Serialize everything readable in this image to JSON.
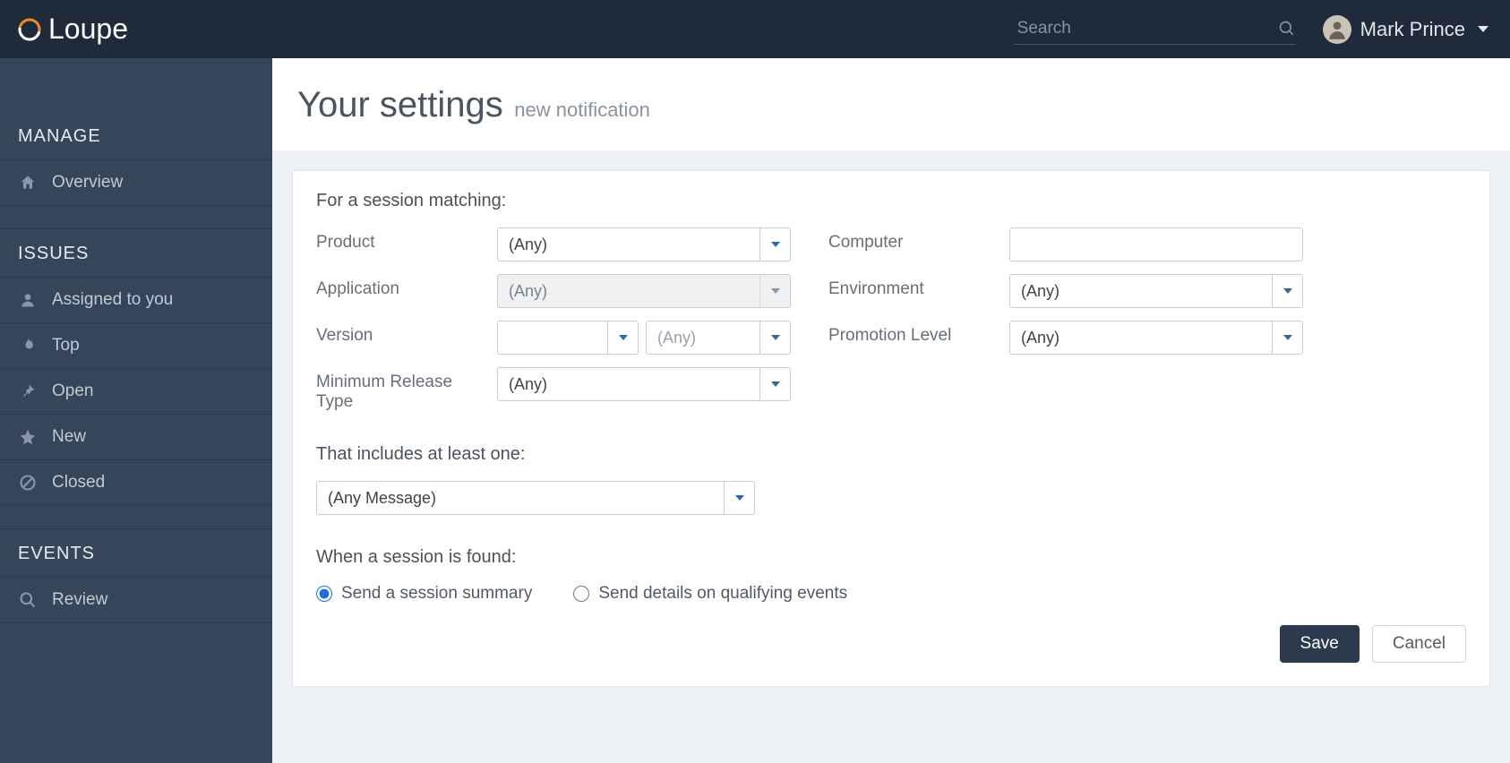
{
  "brand": {
    "name": "Loupe"
  },
  "header": {
    "search_placeholder": "Search",
    "user_name": "Mark Prince"
  },
  "sidebar": {
    "sections": [
      {
        "title": "MANAGE",
        "items": [
          {
            "label": "Overview",
            "icon": "home-icon"
          }
        ]
      },
      {
        "title": "ISSUES",
        "items": [
          {
            "label": "Assigned to you",
            "icon": "user-icon"
          },
          {
            "label": "Top",
            "icon": "flame-icon"
          },
          {
            "label": "Open",
            "icon": "pin-icon"
          },
          {
            "label": "New",
            "icon": "star-icon"
          },
          {
            "label": "Closed",
            "icon": "ban-icon"
          }
        ]
      },
      {
        "title": "EVENTS",
        "items": [
          {
            "label": "Review",
            "icon": "search-icon"
          }
        ]
      }
    ]
  },
  "page": {
    "title": "Your settings",
    "subtitle": "new notification"
  },
  "form": {
    "section_session_label": "For a session matching:",
    "fields": {
      "product": {
        "label": "Product",
        "value": "(Any)"
      },
      "application": {
        "label": "Application",
        "value": "(Any)",
        "disabled": true
      },
      "version": {
        "label": "Version",
        "left_value": "",
        "right_placeholder": "(Any)"
      },
      "min_release": {
        "label": "Minimum Release Type",
        "value": "(Any)"
      },
      "computer": {
        "label": "Computer",
        "value": ""
      },
      "environment": {
        "label": "Environment",
        "value": "(Any)"
      },
      "promotion_level": {
        "label": "Promotion Level",
        "value": "(Any)"
      }
    },
    "section_includes_label": "That includes at least one:",
    "includes_value": "(Any Message)",
    "section_found_label": "When a session is found:",
    "radios": {
      "summary": "Send a session summary",
      "details": "Send details on qualifying events",
      "selected": "summary"
    },
    "buttons": {
      "save": "Save",
      "cancel": "Cancel"
    }
  }
}
